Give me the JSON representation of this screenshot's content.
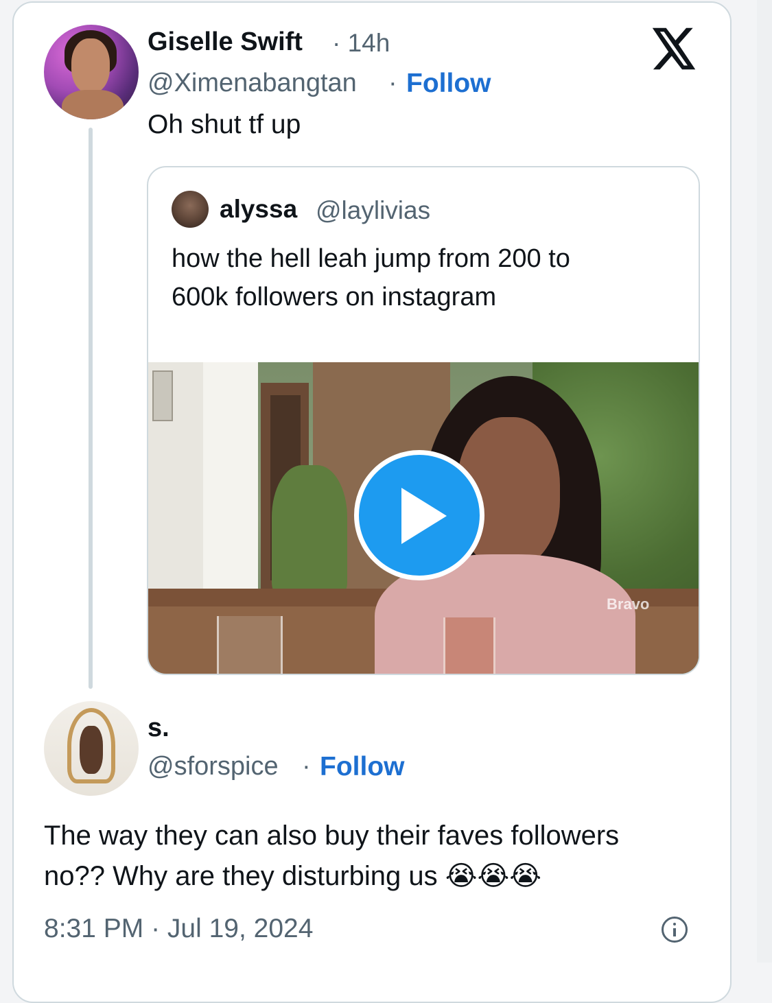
{
  "tweet": {
    "author_name": "Giselle Swift",
    "time_sep": "· 14h",
    "handle": "@Ximenabangtan",
    "handle_sep": "·",
    "follow_label": "Follow",
    "text": "Oh shut tf up",
    "platform_icon": "x-logo-icon"
  },
  "quote": {
    "author_name": "alyssa",
    "handle": "@laylivias",
    "text_lines": [
      "how the hell leah jump from 200 to",
      "600k followers on instagram"
    ],
    "media": {
      "type": "video",
      "play_icon": "play-icon",
      "brand_watermark": "Bravo",
      "play_button_color": "#1d9bf0"
    }
  },
  "reply": {
    "author_name": "s.",
    "handle": "@sforspice",
    "handle_sep": "·",
    "follow_label": "Follow",
    "text_line1": "The way they can also buy their faves followers",
    "text_line2": "no?? Why are they disturbing us",
    "emoji": "😭😭😭",
    "timestamp": "8:31 PM · Jul 19, 2024",
    "info_icon": "info-icon"
  },
  "colors": {
    "link": "#1d6fd1",
    "secondary_text": "#536471",
    "primary_text": "#0f1419",
    "border": "#cfd9de"
  }
}
